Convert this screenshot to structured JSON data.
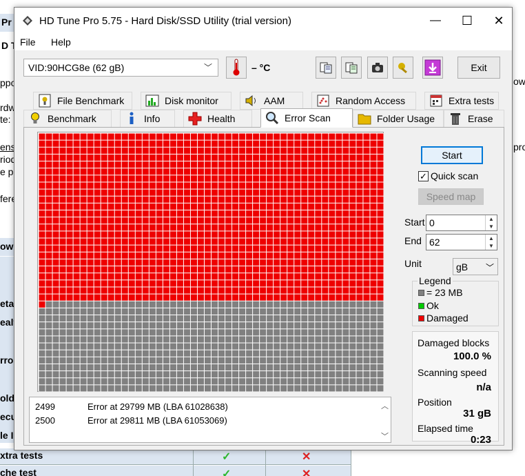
{
  "background": {
    "fragments": [
      "Pr",
      "D T",
      "ow",
      "ppo",
      "rdw",
      "te:",
      "ens",
      "riod",
      "e p",
      "pro",
      "fere",
      "ow",
      "eta",
      "ealt",
      "rror",
      "olde",
      "ecu",
      "le I",
      "xtra tests",
      "che test"
    ]
  },
  "window": {
    "title": "HD Tune Pro 5.75 - Hard Disk/SSD Utility (trial version)",
    "minimize": "—",
    "maximize": "☐",
    "close": "✕"
  },
  "menu": {
    "file": "File",
    "help": "Help"
  },
  "toolbar": {
    "drive": "VID:90HCG8e (62 gB)",
    "temperature": "– °C",
    "exit": "Exit"
  },
  "tabs": {
    "row1": [
      {
        "label": "File Benchmark",
        "icon": "file-benchmark-icon"
      },
      {
        "label": "Disk monitor",
        "icon": "disk-monitor-icon"
      },
      {
        "label": "AAM",
        "icon": "speaker-icon"
      },
      {
        "label": "Random Access",
        "icon": "random-access-icon"
      },
      {
        "label": "Extra tests",
        "icon": "extra-tests-icon"
      }
    ],
    "row2": [
      {
        "label": "Benchmark",
        "icon": "lightbulb-icon"
      },
      {
        "label": "Info",
        "icon": "info-icon"
      },
      {
        "label": "Health",
        "icon": "health-cross-icon"
      },
      {
        "label": "Error Scan",
        "icon": "magnifier-icon"
      },
      {
        "label": "Folder Usage",
        "icon": "folder-icon"
      },
      {
        "label": "Erase",
        "icon": "trash-icon"
      }
    ],
    "active": "Error Scan"
  },
  "scan": {
    "grid_cols": 50,
    "grid_rows": 37,
    "damaged_blocks": 1201,
    "colors": {
      "damaged": "#ee0000",
      "ok": "#00cc00",
      "unscanned": "#808080",
      "grid_line": "#ffffff"
    }
  },
  "log": [
    {
      "num": "2499",
      "msg": "Error at 29799 MB (LBA 61028638)"
    },
    {
      "num": "2500",
      "msg": "Error at 29811 MB (LBA 61053069)"
    }
  ],
  "controls": {
    "start": "Start",
    "quick_scan": "Quick scan",
    "quick_scan_checked": true,
    "speed_map": "Speed map",
    "start_label": "Start",
    "start_value": "0",
    "end_label": "End",
    "end_value": "62",
    "unit_label": "Unit",
    "unit_value": "gB"
  },
  "legend": {
    "title": "Legend",
    "items": [
      {
        "label": "= 23 MB",
        "color": "#808080"
      },
      {
        "label": "Ok",
        "color": "#00cc00"
      },
      {
        "label": "Damaged",
        "color": "#ee0000"
      }
    ]
  },
  "stats": {
    "damaged_label": "Damaged blocks",
    "damaged_value": "100.0 %",
    "speed_label": "Scanning speed",
    "speed_value": "n/a",
    "position_label": "Position",
    "position_value": "31 gB",
    "elapsed_label": "Elapsed time",
    "elapsed_value": "0:23"
  }
}
